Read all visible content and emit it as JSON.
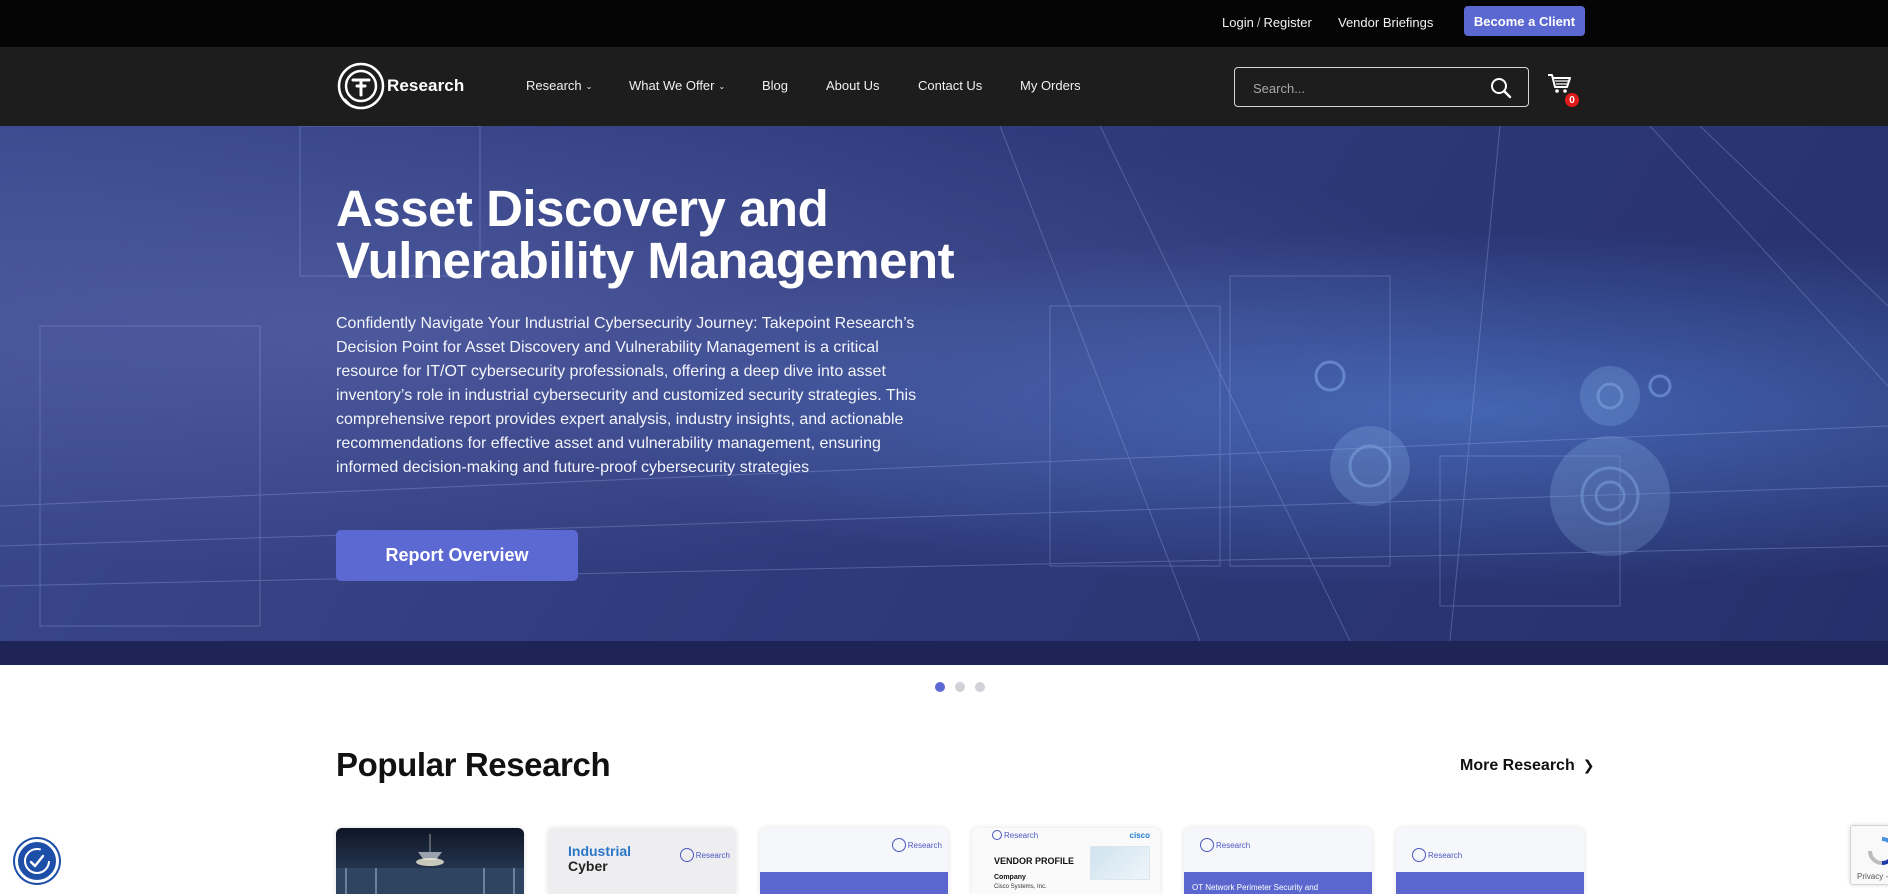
{
  "topbar": {
    "login": "Login",
    "separator": "/",
    "register": "Register",
    "vendor_briefings": "Vendor Briefings",
    "become_client": "Become a Client"
  },
  "nav": {
    "logo_text": "Research",
    "items": [
      {
        "label": "Research",
        "has_dropdown": true
      },
      {
        "label": "What We Offer",
        "has_dropdown": true
      },
      {
        "label": "Blog",
        "has_dropdown": false
      },
      {
        "label": "About Us",
        "has_dropdown": false
      },
      {
        "label": "Contact Us",
        "has_dropdown": false
      },
      {
        "label": "My Orders",
        "has_dropdown": false
      }
    ],
    "search_placeholder": "Search...",
    "cart_count": "0"
  },
  "hero": {
    "title": "Asset Discovery and Vulnerability Management",
    "description": "Confidently Navigate Your Industrial Cybersecurity Journey: Takepoint Research’s Decision Point for Asset Discovery and Vulnerability Management is a critical resource for IT/OT cybersecurity professionals, offering a deep dive into asset inventory’s role in industrial cybersecurity and customized security strategies. This comprehensive report provides expert analysis, industry insights, and actionable recommendations for effective asset and vulnerability management, ensuring informed decision-making and future-proof cybersecurity strategies",
    "button": "Report Overview",
    "slides_total": 3,
    "active_slide": 1
  },
  "popular": {
    "title": "Popular Research",
    "more_link": "More Research",
    "cards": [
      {
        "kind": "photo"
      },
      {
        "kind": "brand",
        "brand_top": "Industrial",
        "brand_bottom": "Cyber",
        "mini_logo": "Research"
      },
      {
        "kind": "report",
        "mini_logo": "Research"
      },
      {
        "kind": "vendor",
        "heading": "VENDOR PROFILE",
        "company_label": "Company",
        "company_name": "Cisco Systems, Inc.",
        "partner": "cisco",
        "mini_logo": "Research"
      },
      {
        "kind": "report",
        "band_text": "OT Network Perimeter Security and",
        "mini_logo": "Research"
      },
      {
        "kind": "report",
        "mini_logo": "Research"
      }
    ]
  },
  "recaptcha": {
    "text": "Privacy - Terms"
  },
  "colors": {
    "accent": "#5c69d3",
    "topbar_bg": "#050505",
    "nav_bg": "#1d1d1d",
    "hero_strip": "#1f2456",
    "cart_badge": "#e01b1b"
  }
}
